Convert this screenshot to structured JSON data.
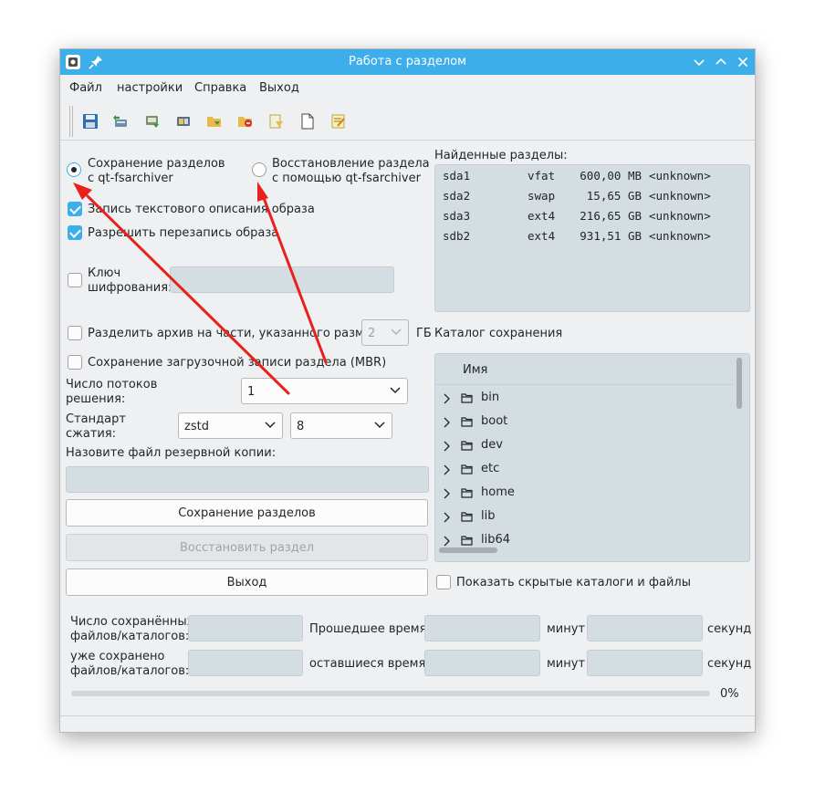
{
  "window": {
    "title": "Работа с разделом",
    "colors": {
      "titlebar": "#3daee9",
      "field": "#d3dde2",
      "annotation": "#e8211c"
    }
  },
  "menu": {
    "file": "Файл",
    "settings": "настройки",
    "help": "Справка",
    "exit": "Выход"
  },
  "toolbar": {
    "icons": [
      "save-icon",
      "disk-backup-icon",
      "disk-restore-icon",
      "partition-icon",
      "folder-open-icon",
      "folder-remove-icon",
      "edit-folder-icon",
      "new-document-icon",
      "notes-icon"
    ]
  },
  "mode": {
    "save_line1": "Сохранение разделов",
    "save_line2": "с qt-fsarchiver",
    "save_selected": true,
    "restore_line1": "Восстановление раздела",
    "restore_line2": "с помощью qt-fsarchiver",
    "restore_selected": false
  },
  "options": {
    "write_description": "Запись текстового описания образа",
    "write_description_checked": true,
    "allow_overwrite": "Разрешить перезапись образа",
    "allow_overwrite_checked": true,
    "encryption_line1": "Ключ",
    "encryption_line2": "шифрования:",
    "encryption_checked": false,
    "encryption_value": "",
    "split_archive": "Разделить архив на части, указанного размера:",
    "split_checked": false,
    "split_size": "2",
    "split_unit": "ГБ",
    "save_mbr": "Сохранение загрузочной записи раздела (MBR)",
    "save_mbr_checked": false
  },
  "threads": {
    "label_line1": "Число потоков",
    "label_line2": "решения:",
    "value": "1"
  },
  "compression": {
    "label_line1": "Стандарт",
    "label_line2": "сжатия:",
    "algorithm": "zstd",
    "level": "8"
  },
  "backup_file": {
    "label": "Назовите файл резервной копии:",
    "value": ""
  },
  "buttons": {
    "save": "Сохранение разделов",
    "restore": "Восстановить раздел",
    "exit": "Выход"
  },
  "partitions": {
    "label": "Найденные разделы:",
    "rows": [
      {
        "device": "sda1",
        "fs": "vfat",
        "size": "600,00 MB",
        "label": "<unknown>"
      },
      {
        "device": "sda2",
        "fs": "swap",
        "size": "15,65 GB",
        "label": "<unknown>"
      },
      {
        "device": "sda3",
        "fs": "ext4",
        "size": "216,65 GB",
        "label": "<unknown>"
      },
      {
        "device": "sdb2",
        "fs": "ext4",
        "size": "931,51 GB",
        "label": "<unknown>"
      }
    ]
  },
  "catalog": {
    "label": "Каталог сохранения",
    "column": "Имя",
    "items": [
      "bin",
      "boot",
      "dev",
      "etc",
      "home",
      "lib",
      "lib64"
    ],
    "show_hidden": "Показать скрытые каталоги и файлы",
    "show_hidden_checked": false
  },
  "stats": {
    "saved_line1": "Число сохранённых",
    "saved_line2": "файлов/каталогов:",
    "saved_value": "",
    "elapsed_label": "Прошедшее время:",
    "elapsed_minutes": "",
    "elapsed_seconds": "",
    "already_line1": "уже сохранено",
    "already_line2": "файлов/каталогов:",
    "already_value": "",
    "remaining_label": "оставшиеся время:",
    "remaining_minutes": "",
    "remaining_seconds": "",
    "minutes": "минут",
    "seconds": "секунд",
    "progress_percent": 0,
    "progress_text": "0%"
  }
}
